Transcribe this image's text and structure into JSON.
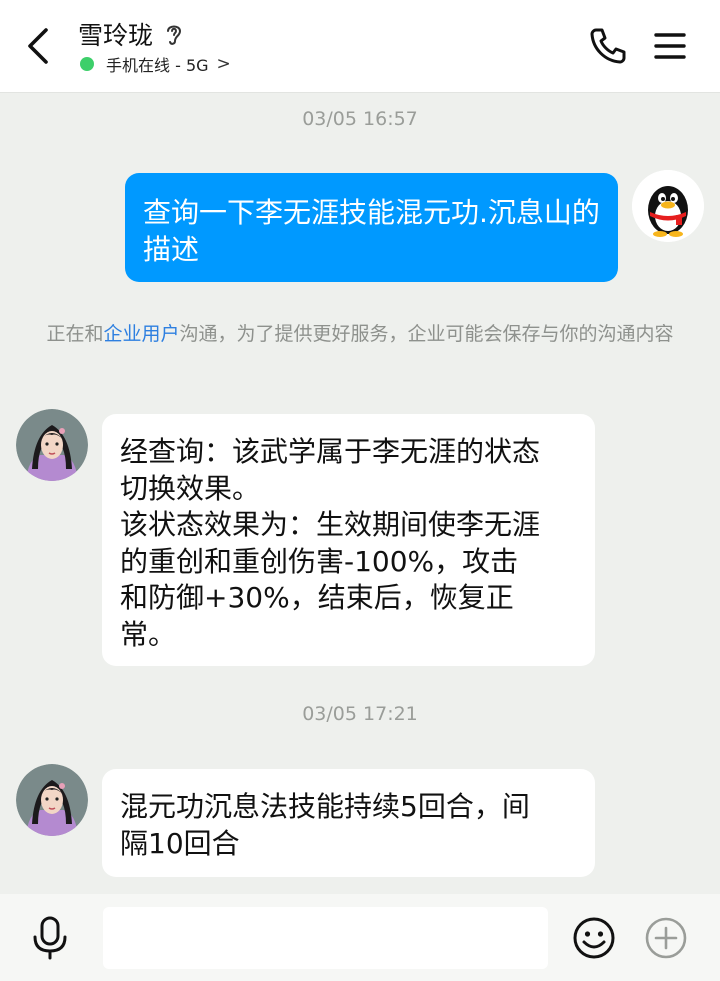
{
  "header": {
    "contact_name": "雪玲珑",
    "status_text": "手机在线 - 5G",
    "status_chevron": ">",
    "icons": [
      "chevron-left-icon",
      "ear-icon",
      "phone-icon",
      "menu-icon"
    ],
    "status_color": "#3dcf6a"
  },
  "messages": {
    "timestamp_1": "03/05 16:57",
    "outgoing_1": "查询一下李无涯技能混元功.沉息山的描述",
    "notice_prefix": "正在和",
    "notice_link": "企业用户",
    "notice_suffix": "沟通，为了提供更好服务，企业可能会保存与你的沟通内容",
    "incoming_1": [
      "经查询：该武学属于李无涯的状态",
      "切换效果。",
      "该状态效果为：生效期间使李无涯",
      "的重创和重创伤害-100%，攻击",
      "和防御+30%，结束后，恢复正",
      "常。"
    ],
    "timestamp_2": "03/05 17:21",
    "incoming_2": [
      "混元功沉息法技能持续5回合，间",
      "隔10回合"
    ]
  },
  "input_bar": {
    "input_value": "",
    "icons": [
      "microphone-icon",
      "emoji-icon",
      "plus-icon"
    ]
  },
  "colors": {
    "outgoing_bubble": "#0099ff",
    "background": "#eef0ed",
    "link": "#2d7fe0"
  }
}
